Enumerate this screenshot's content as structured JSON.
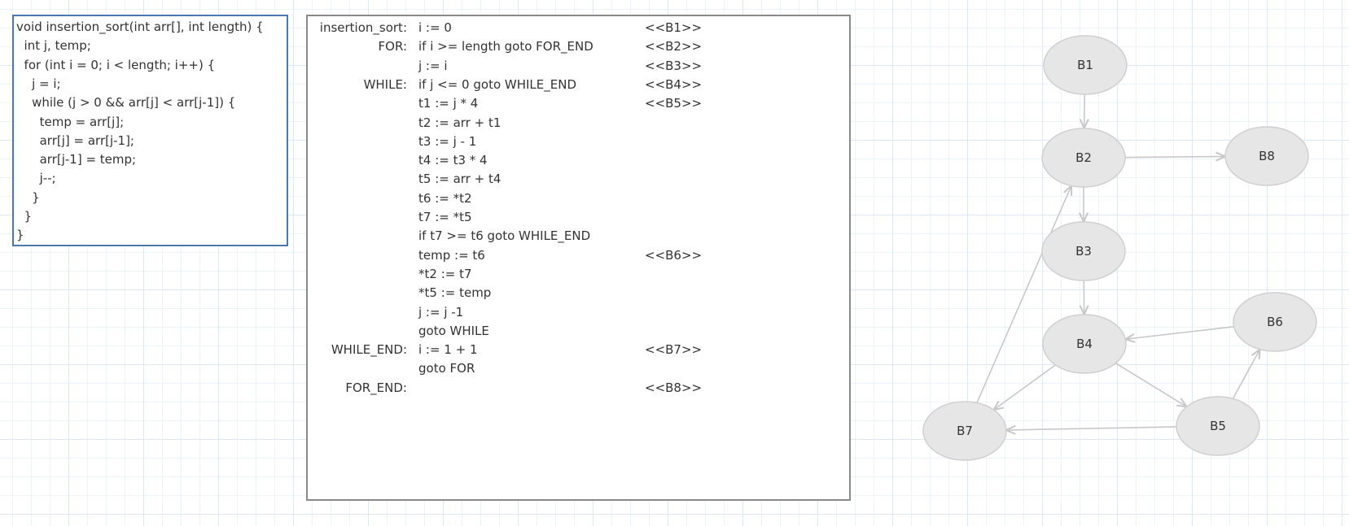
{
  "source_code": {
    "lines": [
      "void insertion_sort(int arr[], int length) {",
      "  int j, temp;",
      "  for (int i = 0; i < length; i++) {",
      "    j = i;",
      "    while (j > 0 && arr[j] < arr[j-1]) {",
      "      temp = arr[j];",
      "      arr[j] = arr[j-1];",
      "      arr[j-1] = temp;",
      "      j--;",
      "    }",
      "  }",
      "}"
    ]
  },
  "ir_code": {
    "rows": [
      {
        "label": "insertion_sort:",
        "code": "i := 0",
        "block": "<<B1>>"
      },
      {
        "label": "FOR:",
        "code": "if i >= length goto FOR_END",
        "block": "<<B2>>"
      },
      {
        "label": "",
        "code": "j := i",
        "block": "<<B3>>"
      },
      {
        "label": "WHILE:",
        "code": "if j <= 0 goto WHILE_END",
        "block": "<<B4>>"
      },
      {
        "label": "",
        "code": "t1 := j * 4",
        "block": "<<B5>>"
      },
      {
        "label": "",
        "code": "t2 := arr + t1",
        "block": ""
      },
      {
        "label": "",
        "code": "t3 := j - 1",
        "block": ""
      },
      {
        "label": "",
        "code": "t4 := t3 * 4",
        "block": ""
      },
      {
        "label": "",
        "code": "t5 := arr + t4",
        "block": ""
      },
      {
        "label": "",
        "code": "t6 := *t2",
        "block": ""
      },
      {
        "label": "",
        "code": "t7 := *t5",
        "block": ""
      },
      {
        "label": "",
        "code": "if t7 >= t6 goto WHILE_END",
        "block": ""
      },
      {
        "label": "",
        "code": "temp := t6",
        "block": "<<B6>>"
      },
      {
        "label": "",
        "code": "*t2 := t7",
        "block": ""
      },
      {
        "label": "",
        "code": "*t5 := temp",
        "block": ""
      },
      {
        "label": "",
        "code": "j := j -1",
        "block": ""
      },
      {
        "label": "",
        "code": "goto WHILE",
        "block": ""
      },
      {
        "label": "WHILE_END:",
        "code": "i := 1 + 1",
        "block": "<<B7>>"
      },
      {
        "label": "",
        "code": "goto FOR",
        "block": ""
      },
      {
        "label": "FOR_END:",
        "code": "",
        "block": "<<B8>>"
      }
    ]
  },
  "cfg": {
    "nodes": [
      {
        "id": "B1",
        "label": "B1"
      },
      {
        "id": "B2",
        "label": "B2"
      },
      {
        "id": "B3",
        "label": "B3"
      },
      {
        "id": "B4",
        "label": "B4"
      },
      {
        "id": "B5",
        "label": "B5"
      },
      {
        "id": "B6",
        "label": "B6"
      },
      {
        "id": "B7",
        "label": "B7"
      },
      {
        "id": "B8",
        "label": "B8"
      }
    ],
    "edges": [
      {
        "from": "B1",
        "to": "B2"
      },
      {
        "from": "B2",
        "to": "B3"
      },
      {
        "from": "B2",
        "to": "B8"
      },
      {
        "from": "B3",
        "to": "B4"
      },
      {
        "from": "B4",
        "to": "B5"
      },
      {
        "from": "B4",
        "to": "B7"
      },
      {
        "from": "B5",
        "to": "B6"
      },
      {
        "from": "B5",
        "to": "B7"
      },
      {
        "from": "B6",
        "to": "B4"
      },
      {
        "from": "B7",
        "to": "B2"
      }
    ]
  },
  "colors": {
    "source_border": "#4a78b0",
    "ir_border": "#8a8a8a",
    "node_fill": "#e6e6e6",
    "edge": "#c8c8c8"
  }
}
